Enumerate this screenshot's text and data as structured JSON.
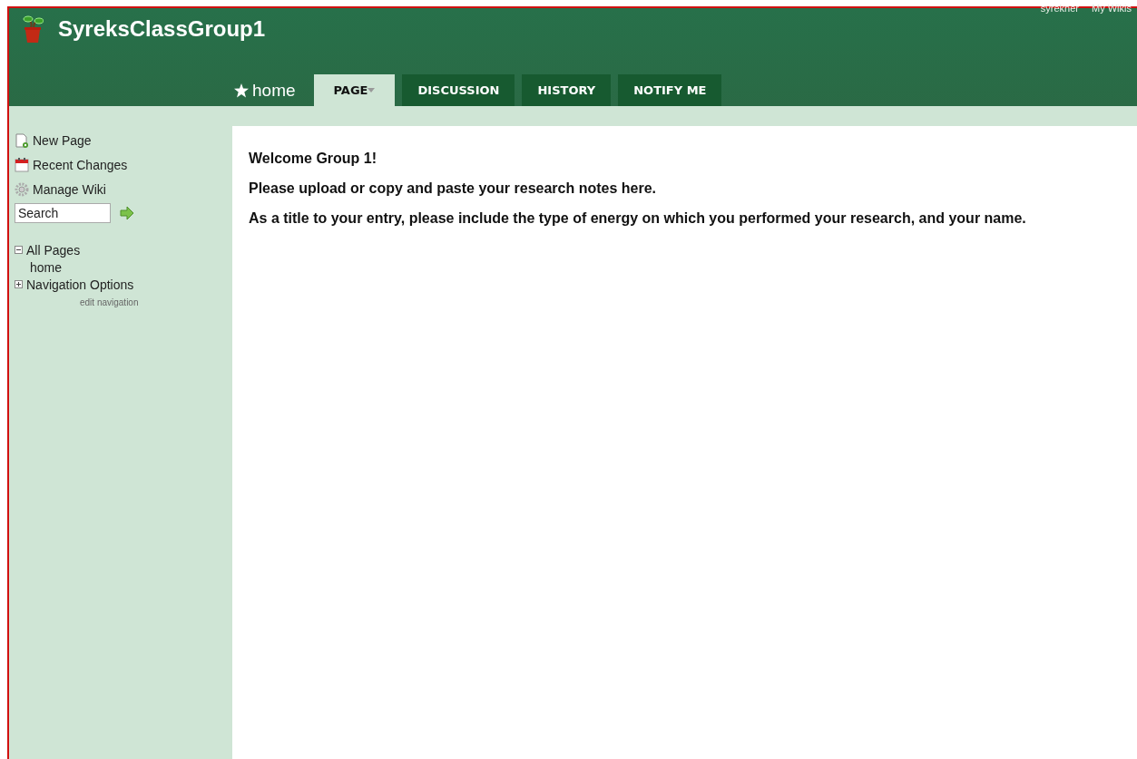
{
  "header": {
    "site_title": "SyreksClassGroup1",
    "user_links": [
      "syrekner",
      "My Wikis"
    ]
  },
  "tabs": [
    {
      "label": "home",
      "kind": "page",
      "selected": false
    },
    {
      "label": "PAGE",
      "kind": "menu",
      "selected": true
    },
    {
      "label": "DISCUSSION",
      "kind": "tab",
      "selected": false
    },
    {
      "label": "HISTORY",
      "kind": "tab",
      "selected": false
    },
    {
      "label": "NOTIFY ME",
      "kind": "tab",
      "selected": false
    }
  ],
  "sidebar": {
    "actions": [
      {
        "label": "New Page",
        "kind": "new"
      },
      {
        "label": "Recent Changes",
        "kind": "calendar"
      },
      {
        "label": "Manage Wiki",
        "kind": "gear"
      }
    ],
    "search": {
      "value": "Search"
    },
    "tree": [
      {
        "label": "All Pages",
        "expanded": true,
        "children": [
          {
            "label": "home"
          }
        ]
      },
      {
        "label": "Navigation Options",
        "expanded": false
      }
    ],
    "edit_link": "edit navigation"
  },
  "content": {
    "paragraphs": [
      "Welcome Group 1!",
      "Please upload or copy and paste your research notes here.",
      "As a title to your entry, please include the type of energy on which you performed your research, and your name."
    ]
  }
}
